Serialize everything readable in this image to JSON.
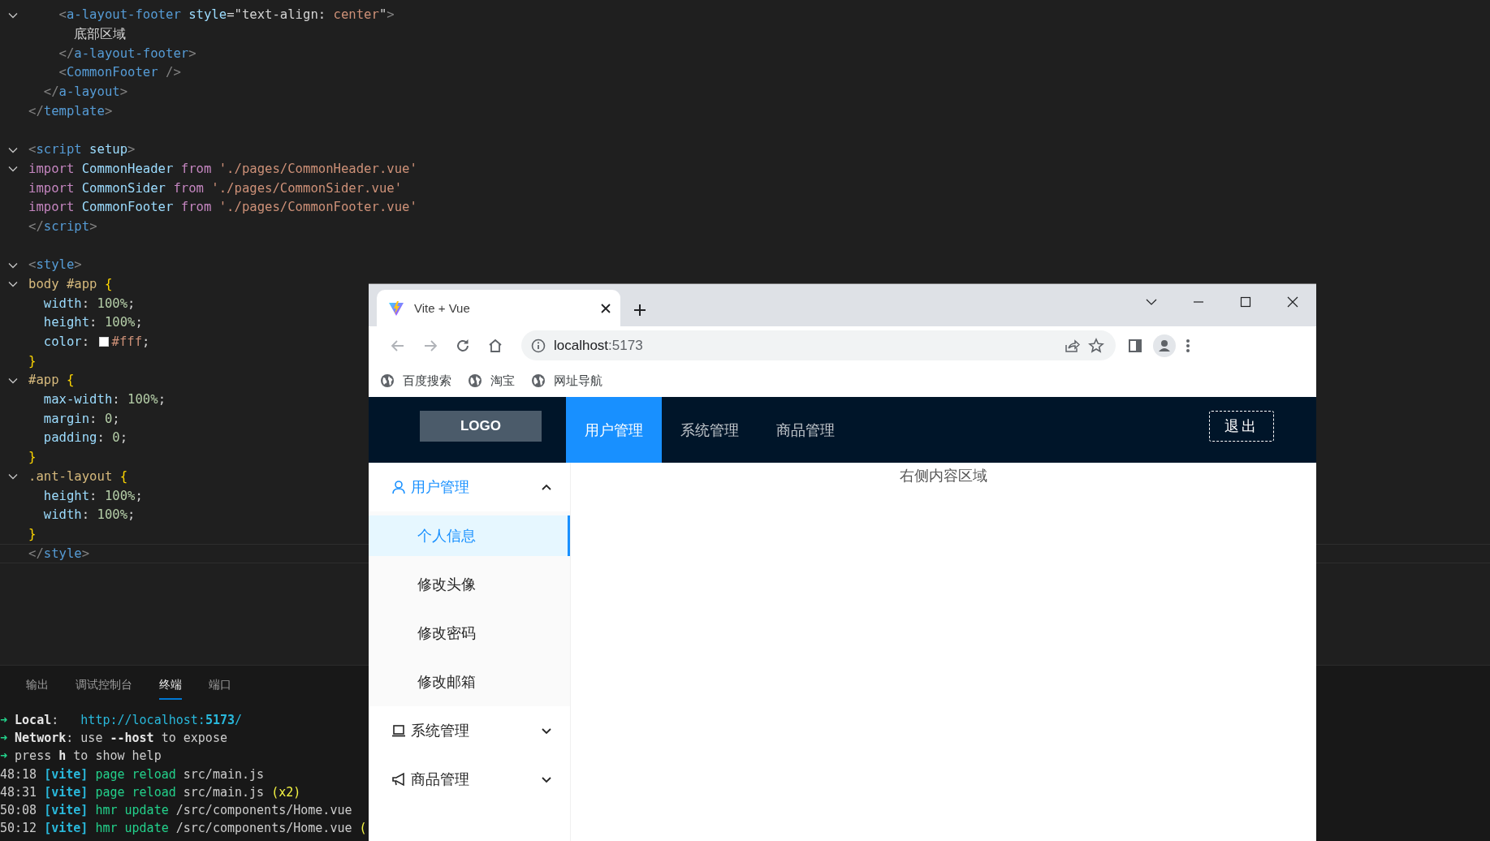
{
  "editor": {
    "code_lines": [
      {
        "foldable": true,
        "current": false,
        "tokens": [
          {
            "kind": "punct",
            "text": "    <"
          },
          {
            "kind": "tag",
            "text": "a-layout-footer"
          },
          {
            "kind": "attr",
            "text": " style"
          },
          {
            "kind": "plain",
            "text": "=\"text-align: "
          },
          {
            "kind": "string",
            "text": "center"
          },
          {
            "kind": "plain",
            "text": "\""
          },
          {
            "kind": "punct",
            "text": ">"
          }
        ]
      },
      {
        "foldable": false,
        "current": false,
        "tokens": [
          {
            "kind": "plain",
            "text": "      底部区域"
          }
        ]
      },
      {
        "foldable": false,
        "current": false,
        "tokens": [
          {
            "kind": "punct",
            "text": "    </"
          },
          {
            "kind": "tag",
            "text": "a-layout-footer"
          },
          {
            "kind": "punct",
            "text": ">"
          }
        ]
      },
      {
        "foldable": false,
        "current": false,
        "tokens": [
          {
            "kind": "punct",
            "text": "    <"
          },
          {
            "kind": "tag",
            "text": "CommonFooter"
          },
          {
            "kind": "punct",
            "text": " />"
          }
        ]
      },
      {
        "foldable": false,
        "current": false,
        "tokens": [
          {
            "kind": "punct",
            "text": "  </"
          },
          {
            "kind": "tag",
            "text": "a-layout"
          },
          {
            "kind": "punct",
            "text": ">"
          }
        ]
      },
      {
        "foldable": false,
        "current": false,
        "tokens": [
          {
            "kind": "punct",
            "text": "</"
          },
          {
            "kind": "tag",
            "text": "template"
          },
          {
            "kind": "punct",
            "text": ">"
          }
        ]
      },
      {
        "foldable": false,
        "current": false
      },
      {
        "foldable": true,
        "current": false,
        "tokens": [
          {
            "kind": "punct",
            "text": "<"
          },
          {
            "kind": "tag",
            "text": "script"
          },
          {
            "kind": "attr",
            "text": " setup"
          },
          {
            "kind": "punct",
            "text": ">"
          }
        ]
      },
      {
        "foldable": true,
        "current": false,
        "tokens": [
          {
            "kind": "keyword",
            "text": "import "
          },
          {
            "kind": "attr",
            "text": "CommonHeader "
          },
          {
            "kind": "keyword",
            "text": "from "
          },
          {
            "kind": "string",
            "text": "'./pages/CommonHeader.vue'"
          }
        ]
      },
      {
        "foldable": false,
        "current": false,
        "tokens": [
          {
            "kind": "keyword",
            "text": "import "
          },
          {
            "kind": "attr",
            "text": "CommonSider "
          },
          {
            "kind": "keyword",
            "text": "from "
          },
          {
            "kind": "string",
            "text": "'./pages/CommonSider.vue'"
          }
        ]
      },
      {
        "foldable": false,
        "current": false,
        "tokens": [
          {
            "kind": "keyword",
            "text": "import "
          },
          {
            "kind": "attr",
            "text": "CommonFooter "
          },
          {
            "kind": "keyword",
            "text": "from "
          },
          {
            "kind": "string",
            "text": "'./pages/CommonFooter.vue'"
          }
        ]
      },
      {
        "foldable": false,
        "current": false,
        "tokens": [
          {
            "kind": "punct",
            "text": "</"
          },
          {
            "kind": "tag",
            "text": "script"
          },
          {
            "kind": "punct",
            "text": ">"
          }
        ]
      },
      {
        "foldable": false,
        "current": false
      },
      {
        "foldable": true,
        "current": false,
        "tokens": [
          {
            "kind": "punct",
            "text": "<"
          },
          {
            "kind": "tag",
            "text": "style"
          },
          {
            "kind": "punct",
            "text": ">"
          }
        ]
      },
      {
        "foldable": true,
        "current": false,
        "tokens": [
          {
            "kind": "selector",
            "text": "body #app "
          },
          {
            "kind": "brace",
            "text": "{"
          }
        ]
      },
      {
        "foldable": false,
        "current": false,
        "tokens": [
          {
            "kind": "prop",
            "text": "  width"
          },
          {
            "kind": "plain",
            "text": ": "
          },
          {
            "kind": "number",
            "text": "100%"
          },
          {
            "kind": "plain",
            "text": ";"
          }
        ]
      },
      {
        "foldable": false,
        "current": false,
        "tokens": [
          {
            "kind": "prop",
            "text": "  height"
          },
          {
            "kind": "plain",
            "text": ": "
          },
          {
            "kind": "number",
            "text": "100%"
          },
          {
            "kind": "plain",
            "text": ";"
          }
        ]
      },
      {
        "foldable": false,
        "current": false,
        "tokens": [
          {
            "kind": "prop",
            "text": "  color"
          },
          {
            "kind": "plain",
            "text": ": "
          },
          {
            "kind": "swatch",
            "color": "#ffffff"
          },
          {
            "kind": "string",
            "text": "#fff"
          },
          {
            "kind": "plain",
            "text": ";"
          }
        ]
      },
      {
        "foldable": false,
        "current": false,
        "tokens": [
          {
            "kind": "brace",
            "text": "}"
          }
        ]
      },
      {
        "foldable": true,
        "current": false,
        "tokens": [
          {
            "kind": "selector",
            "text": "#app "
          },
          {
            "kind": "brace",
            "text": "{"
          }
        ]
      },
      {
        "foldable": false,
        "current": false,
        "tokens": [
          {
            "kind": "prop",
            "text": "  max-width"
          },
          {
            "kind": "plain",
            "text": ": "
          },
          {
            "kind": "number",
            "text": "100%"
          },
          {
            "kind": "plain",
            "text": ";"
          }
        ]
      },
      {
        "foldable": false,
        "current": false,
        "tokens": [
          {
            "kind": "prop",
            "text": "  margin"
          },
          {
            "kind": "plain",
            "text": ": "
          },
          {
            "kind": "number",
            "text": "0"
          },
          {
            "kind": "plain",
            "text": ";"
          }
        ]
      },
      {
        "foldable": false,
        "current": false,
        "tokens": [
          {
            "kind": "prop",
            "text": "  padding"
          },
          {
            "kind": "plain",
            "text": ": "
          },
          {
            "kind": "number",
            "text": "0"
          },
          {
            "kind": "plain",
            "text": ";"
          }
        ]
      },
      {
        "foldable": false,
        "current": false,
        "tokens": [
          {
            "kind": "brace",
            "text": "}"
          }
        ]
      },
      {
        "foldable": true,
        "current": false,
        "tokens": [
          {
            "kind": "selector",
            "text": ".ant-layout "
          },
          {
            "kind": "brace",
            "text": "{"
          }
        ]
      },
      {
        "foldable": false,
        "current": false,
        "tokens": [
          {
            "kind": "prop",
            "text": "  height"
          },
          {
            "kind": "plain",
            "text": ": "
          },
          {
            "kind": "number",
            "text": "100%"
          },
          {
            "kind": "plain",
            "text": ";"
          }
        ]
      },
      {
        "foldable": false,
        "current": false,
        "tokens": [
          {
            "kind": "prop",
            "text": "  width"
          },
          {
            "kind": "plain",
            "text": ": "
          },
          {
            "kind": "number",
            "text": "100%"
          },
          {
            "kind": "plain",
            "text": ";"
          }
        ]
      },
      {
        "foldable": false,
        "current": false,
        "tokens": [
          {
            "kind": "brace",
            "text": "}"
          }
        ]
      },
      {
        "foldable": false,
        "current": true,
        "tokens": [
          {
            "kind": "punct",
            "text": "</"
          },
          {
            "kind": "tag",
            "text": "style"
          },
          {
            "kind": "punct",
            "text": ">"
          }
        ]
      }
    ]
  },
  "panel": {
    "tabs": [
      {
        "label": "输出",
        "selected": false
      },
      {
        "label": "调试控制台",
        "selected": false
      },
      {
        "label": "终端",
        "selected": true
      },
      {
        "label": "端口",
        "selected": false
      }
    ],
    "terminal_lines": [
      {
        "tokens": [
          {
            "kind": "arrow",
            "text": "➜"
          },
          {
            "kind": "bold",
            "text": " Local"
          },
          {
            "kind": "plain",
            "text": ":   "
          },
          {
            "kind": "url",
            "text": "http://localhost:"
          },
          {
            "kind": "url_bold",
            "text": "5173"
          },
          {
            "kind": "url",
            "text": "/"
          }
        ]
      },
      {
        "tokens": [
          {
            "kind": "arrow",
            "text": "➜"
          },
          {
            "kind": "bold",
            "text": " Network"
          },
          {
            "kind": "plain",
            "text": ": use "
          },
          {
            "kind": "bold",
            "text": "--host"
          },
          {
            "kind": "plain",
            "text": " to expose"
          }
        ]
      },
      {
        "tokens": [
          {
            "kind": "arrow",
            "text": "➜"
          },
          {
            "kind": "plain",
            "text": " press "
          },
          {
            "kind": "bold",
            "text": "h"
          },
          {
            "kind": "plain",
            "text": " to show help"
          }
        ]
      },
      {
        "tokens": [
          {
            "kind": "plain",
            "text": "48:18 "
          },
          {
            "kind": "vite",
            "text": "[vite]"
          },
          {
            "kind": "green",
            "text": " page reload"
          },
          {
            "kind": "plain",
            "text": " src/main.js"
          }
        ]
      },
      {
        "tokens": [
          {
            "kind": "plain",
            "text": "48:31 "
          },
          {
            "kind": "vite",
            "text": "[vite]"
          },
          {
            "kind": "green",
            "text": " page reload"
          },
          {
            "kind": "plain",
            "text": " src/main.js "
          },
          {
            "kind": "yellow",
            "text": "(x2)"
          }
        ]
      },
      {
        "tokens": [
          {
            "kind": "plain",
            "text": "50:08 "
          },
          {
            "kind": "vite",
            "text": "[vite]"
          },
          {
            "kind": "green",
            "text": " hmr update"
          },
          {
            "kind": "plain",
            "text": " /src/components/Home.vue"
          }
        ]
      },
      {
        "tokens": [
          {
            "kind": "plain",
            "text": "50:12 "
          },
          {
            "kind": "vite",
            "text": "[vite]"
          },
          {
            "kind": "green",
            "text": " hmr update"
          },
          {
            "kind": "plain",
            "text": " /src/components/Home.vue "
          },
          {
            "kind": "yellow",
            "text": "("
          }
        ]
      }
    ]
  },
  "browser": {
    "tab": {
      "title": "Vite + Vue"
    },
    "nav": {
      "back_disabled": true,
      "forward_disabled": true
    },
    "address": {
      "host": "localhost",
      "port": ":5173"
    },
    "bookmarks": [
      {
        "label": "百度搜索"
      },
      {
        "label": "淘宝"
      },
      {
        "label": "网址导航"
      }
    ]
  },
  "app": {
    "logo": "LOGO",
    "nav": [
      {
        "label": "用户管理",
        "selected": true
      },
      {
        "label": "系统管理",
        "selected": false
      },
      {
        "label": "商品管理",
        "selected": false
      }
    ],
    "logout": "退出",
    "sider": [
      {
        "label": "用户管理",
        "expanded": true,
        "children": [
          {
            "label": "个人信息",
            "selected": true
          },
          {
            "label": "修改头像",
            "selected": false
          },
          {
            "label": "修改密码",
            "selected": false
          },
          {
            "label": "修改邮箱",
            "selected": false
          }
        ]
      },
      {
        "label": "系统管理",
        "expanded": false
      },
      {
        "label": "商品管理",
        "expanded": false
      }
    ],
    "content": "右侧内容区域"
  }
}
